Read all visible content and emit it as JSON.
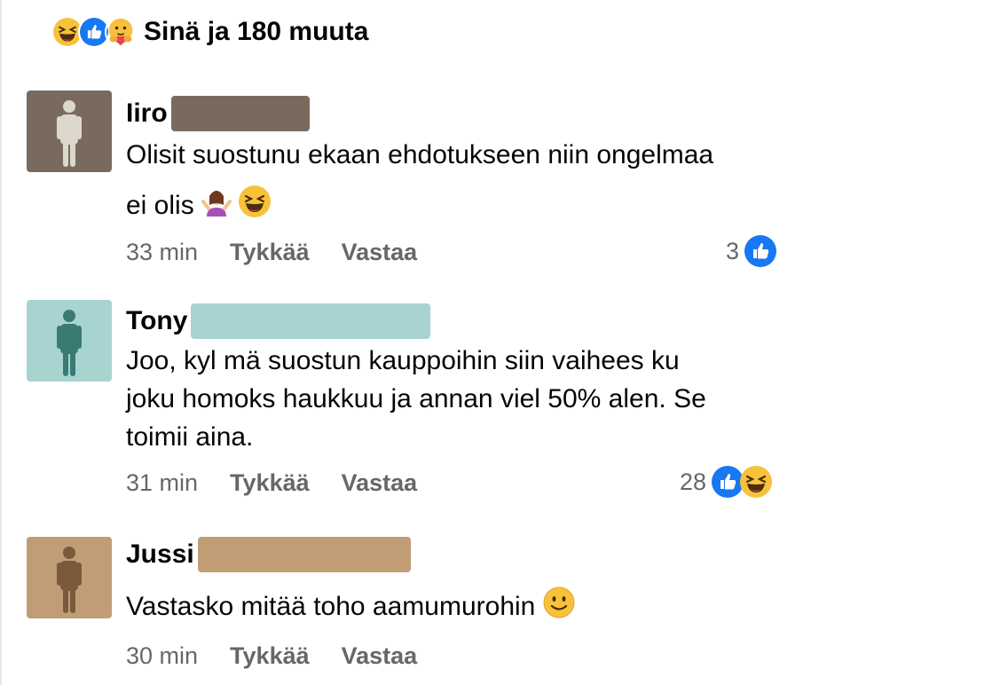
{
  "reactions": {
    "icons": [
      "laugh-icon",
      "like-icon",
      "care-icon"
    ],
    "text": "Sinä ja 180 muuta"
  },
  "comments": [
    {
      "author": "Iiro",
      "text_lines": [
        "Olisit suostunu ekaan ehdotukseen niin ongelmaa",
        "ei olis"
      ],
      "emojis": [
        "shrug-emoji",
        "laughing-emoji"
      ],
      "time": "33 min",
      "like_label": "Tykkää",
      "reply_label": "Vastaa",
      "reaction_count": "3",
      "reaction_icons": [
        "like-icon"
      ],
      "avatar_bg": "#7a6a5e",
      "avatar_fg": "#ddd8cc",
      "redact_color": "#7a6a5e"
    },
    {
      "author": "Tony",
      "text_lines": [
        "Joo, kyl mä suostun kauppoihin siin vaihees ku",
        "joku homoks haukkuu ja annan viel 50% alen. Se",
        "toimii aina."
      ],
      "time": "31 min",
      "like_label": "Tykkää",
      "reply_label": "Vastaa",
      "reaction_count": "28",
      "reaction_icons": [
        "like-icon",
        "laugh-icon"
      ],
      "avatar_bg": "#a7d4d1",
      "avatar_fg": "#3a7a73",
      "redact_color": "#a7d4d1"
    },
    {
      "author": "Jussi",
      "text_lines": [
        "Vastasko mitää toho aamumurohin"
      ],
      "emojis": [
        "smile-emoji"
      ],
      "time": "30 min",
      "like_label": "Tykkää",
      "reply_label": "Vastaa",
      "avatar_bg": "#c19d76",
      "avatar_fg": "#7a5a3c",
      "redact_color": "#c19d76"
    }
  ]
}
